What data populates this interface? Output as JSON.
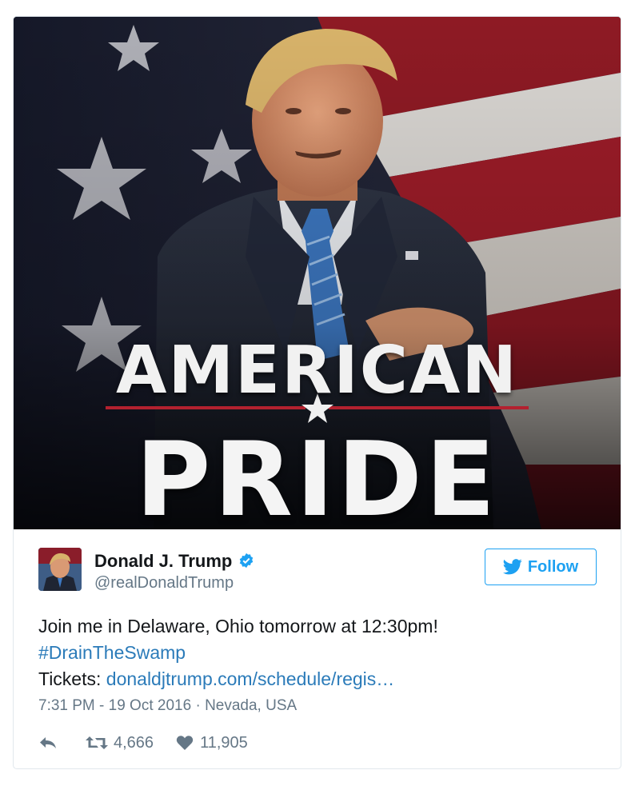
{
  "media": {
    "overlay_line1": "AMERICAN",
    "overlay_line2": "PRIDE"
  },
  "user": {
    "name": "Donald J. Trump",
    "handle": "@realDonaldTrump",
    "verified": true
  },
  "follow_label": "Follow",
  "tweet": {
    "line1": "Join me in Delaware, Ohio tomorrow at 12:30pm!",
    "hashtag": "#DrainTheSwamp",
    "tickets_label": "Tickets:",
    "tickets_link": "donaldjtrump.com/schedule/regis…"
  },
  "meta": {
    "timestamp": "7:31 PM - 19 Oct 2016",
    "separator": "·",
    "location": "Nevada, USA"
  },
  "actions": {
    "retweets": "4,666",
    "likes": "11,905"
  },
  "colors": {
    "link": "#2b7bb9",
    "twitter_blue": "#1da1f2",
    "secondary_text": "#657786",
    "stripe_red": "#b3212f"
  },
  "icons": [
    "verified-badge-icon",
    "twitter-bird-icon",
    "reply-icon",
    "retweet-icon",
    "heart-icon"
  ]
}
